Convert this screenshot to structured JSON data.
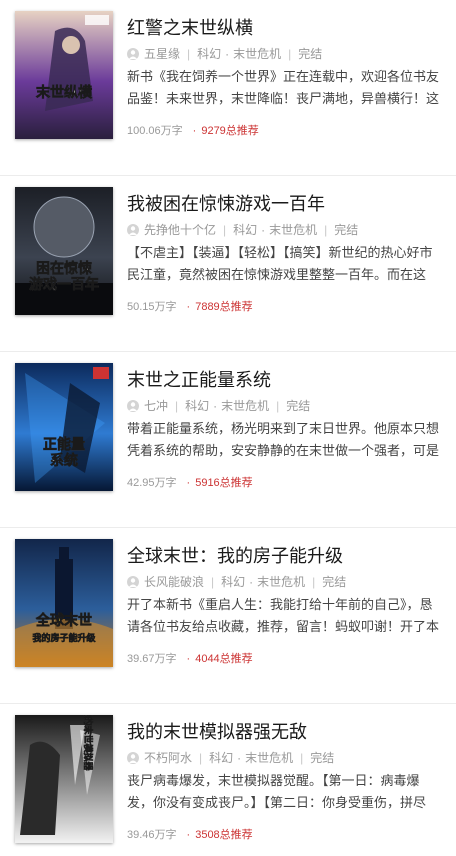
{
  "books": [
    {
      "title": "红警之末世纵横",
      "author": "五星缘",
      "category": "科幻",
      "subcategory": "末世危机",
      "status": "完结",
      "description": "新书《我在饲养一个世界》正在连载中，欢迎各位书友品鉴！未来世界，末世降临！丧尸满地，异兽横行！这",
      "words": "100.06万字",
      "recommend": "9279总推荐",
      "cover_text": [
        "末世纵横"
      ],
      "cover_colors": [
        "#e7d2c3",
        "#6b3b9a",
        "#2a1f3d"
      ]
    },
    {
      "title": "我被困在惊悚游戏一百年",
      "author": "先挣他十个亿",
      "category": "科幻",
      "subcategory": "末世危机",
      "status": "完结",
      "description": "【不虐主】【装逼】【轻松】【搞笑】新世纪的热心好市民江童，竟然被困在惊悚游戏里整整一百年。而在这",
      "words": "50.15万字",
      "recommend": "7889总推荐",
      "cover_text": [
        "困在惊悚",
        "游戏一百年"
      ],
      "cover_colors": [
        "#1c1f26",
        "#3c4350",
        "#0e0f12"
      ]
    },
    {
      "title": "末世之正能量系统",
      "author": "七冲",
      "category": "科幻",
      "subcategory": "末世危机",
      "status": "完结",
      "description": "带着正能量系统，杨光明来到了末日世界。他原本只想凭着系统的帮助，安安静静的在末世做一个强者，可是",
      "words": "42.95万字",
      "recommend": "5916总推荐",
      "cover_text": [
        "正能量",
        "系统"
      ],
      "cover_colors": [
        "#0c2a5c",
        "#2f7bd2",
        "#061734"
      ]
    },
    {
      "title": "全球末世：我的房子能升级",
      "author": "长风能破浪",
      "category": "科幻",
      "subcategory": "末世危机",
      "status": "完结",
      "description": "开了本新书《重启人生：我能打给十年前的自己》，恳请各位书友给点收藏，推荐，留言！蚂蚁叩谢！开了本",
      "words": "39.67万字",
      "recommend": "4044总推荐",
      "cover_text": [
        "全球末世",
        "我的房子能升级"
      ],
      "cover_colors": [
        "#12264a",
        "#2c5e9b",
        "#c77a1c"
      ]
    },
    {
      "title": "我的末世模拟器强无敌",
      "author": "不朽阿水",
      "category": "科幻",
      "subcategory": "末世危机",
      "status": "完结",
      "description": "丧尸病毒爆发，末世模拟器觉醒。【第一日：病毒爆发，你没有变成丧尸。】【第二日：你身受重伤，拼尽",
      "words": "39.46万字",
      "recommend": "3508总推荐",
      "cover_text": [
        "我的末世模拟器"
      ],
      "cover_colors": [
        "#1a1a1a",
        "#8e8e8e",
        "#f2f2f2"
      ]
    }
  ]
}
